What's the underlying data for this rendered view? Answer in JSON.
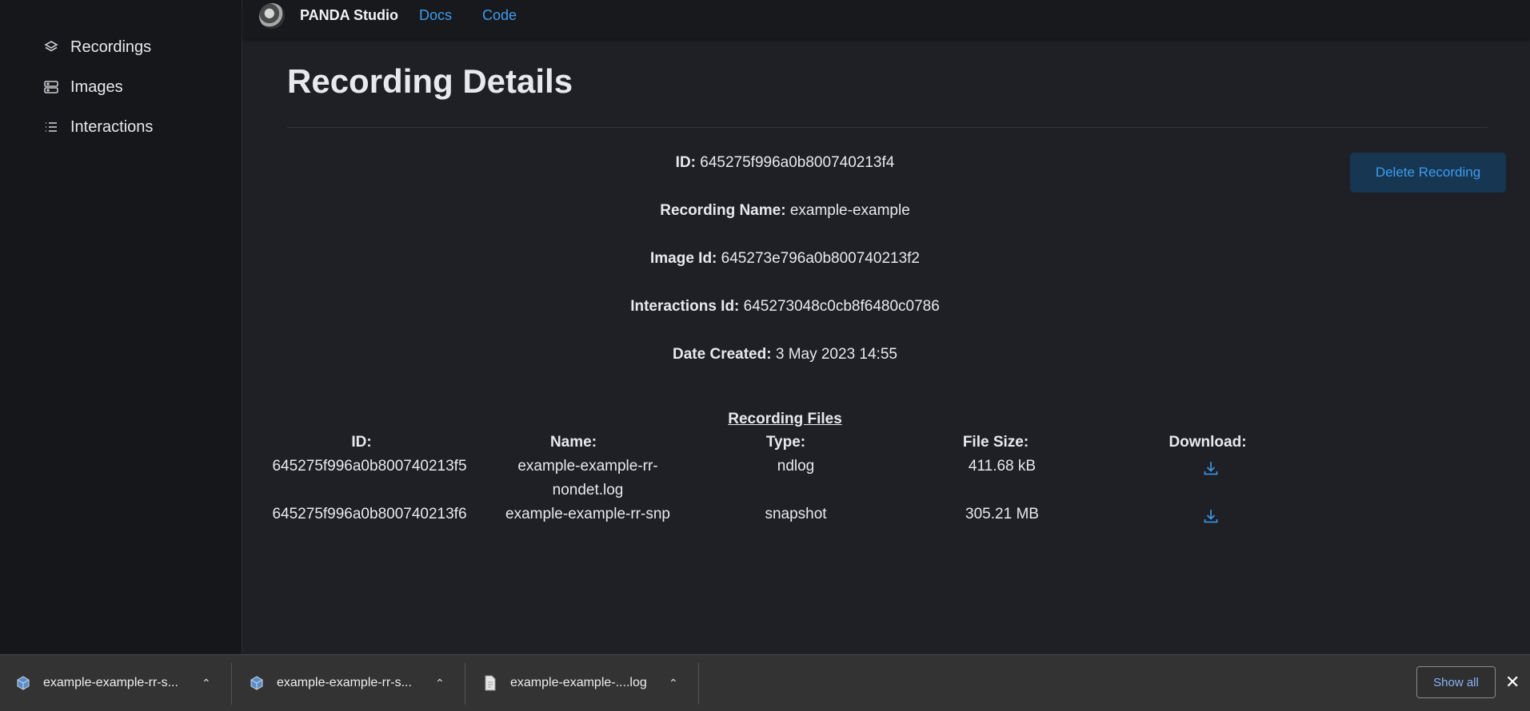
{
  "sidebar": {
    "items": [
      {
        "label": "Recordings",
        "icon": "layers-icon"
      },
      {
        "label": "Images",
        "icon": "server-icon"
      },
      {
        "label": "Interactions",
        "icon": "list-icon"
      }
    ]
  },
  "header": {
    "brand": "PANDA Studio",
    "links": [
      "Docs",
      "Code"
    ]
  },
  "main": {
    "title": "Recording Details",
    "delete_button": "Delete Recording",
    "details": [
      {
        "label": "ID:",
        "value": "645275f996a0b800740213f4"
      },
      {
        "label": "Recording Name:",
        "value": "example-example"
      },
      {
        "label": "Image Id:",
        "value": "645273e796a0b800740213f2"
      },
      {
        "label": "Interactions Id:",
        "value": "645273048c0cb8f6480c0786"
      },
      {
        "label": "Date Created:",
        "value": "3 May 2023 14:55"
      }
    ],
    "files": {
      "title": "Recording Files",
      "headers": [
        "ID:",
        "Name:",
        "Type:",
        "File Size:",
        "Download:"
      ],
      "rows": [
        {
          "id": "645275f996a0b800740213f5",
          "name": "example-example-rr-nondet.log",
          "type": "ndlog",
          "size": "411.68 kB"
        },
        {
          "id": "645275f996a0b800740213f6",
          "name": "example-example-rr-snp",
          "type": "snapshot",
          "size": "305.21 MB"
        }
      ]
    }
  },
  "downloads": {
    "items": [
      {
        "name": "example-example-rr-s...",
        "icon": "package-icon"
      },
      {
        "name": "example-example-rr-s...",
        "icon": "package-icon"
      },
      {
        "name": "example-example-....log",
        "icon": "document-icon"
      }
    ],
    "show_all": "Show all",
    "close": "✕"
  },
  "colors": {
    "accent": "#3e9bf0",
    "background": "#1e2025",
    "sidebar": "#16171b",
    "delete_button_bg": "#163651"
  }
}
